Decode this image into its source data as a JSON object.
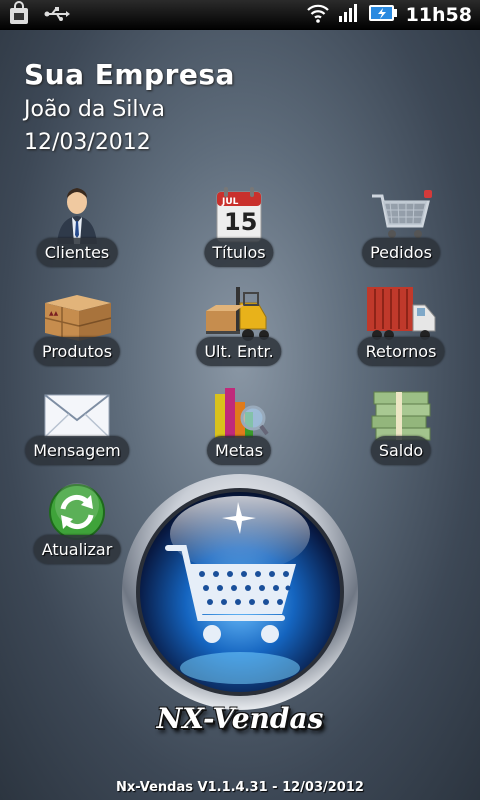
{
  "status_bar": {
    "time": "11h58"
  },
  "header": {
    "company": "Sua Empresa",
    "user": "João da Silva",
    "date": "12/03/2012"
  },
  "menu": {
    "clientes": "Clientes",
    "titulos": "Títulos",
    "pedidos": "Pedidos",
    "produtos": "Produtos",
    "ult_entr": "Ult. Entr.",
    "retornos": "Retornos",
    "mensagem": "Mensagem",
    "metas": "Metas",
    "saldo": "Saldo",
    "atualizar": "Atualizar"
  },
  "calendar_icon": {
    "month": "JUL",
    "day": "15"
  },
  "brand": "NX-Vendas",
  "version": "Nx-Vendas V1.1.4.31 - 12/03/2012"
}
